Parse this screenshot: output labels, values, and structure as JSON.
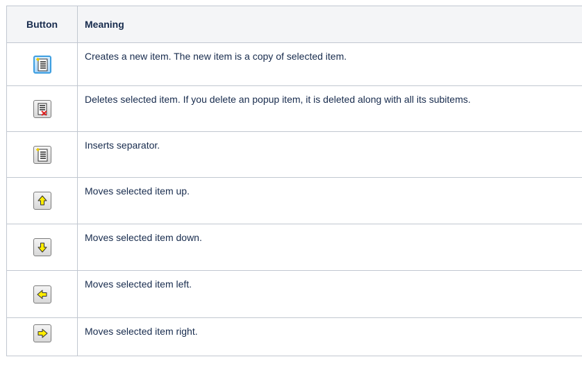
{
  "table": {
    "headers": {
      "button": "Button",
      "meaning": "Meaning"
    },
    "rows": [
      {
        "icon": "new-item-icon",
        "text": "Creates a new item. The new item is a copy of selected item."
      },
      {
        "icon": "delete-item-icon",
        "text": "Deletes selected item. If you delete an popup item, it is deleted along with all its subitems."
      },
      {
        "icon": "insert-separator-icon",
        "text": "Inserts separator."
      },
      {
        "icon": "arrow-up-icon",
        "text": "Moves selected item up."
      },
      {
        "icon": "arrow-down-icon",
        "text": "Moves selected item down."
      },
      {
        "icon": "arrow-left-icon",
        "text": "Moves selected item left."
      },
      {
        "icon": "arrow-right-icon",
        "text": "Moves selected item right."
      }
    ]
  },
  "colors": {
    "header_bg": "#f4f5f7",
    "border": "#c1c7d0",
    "arrow_fill": "#ffee00",
    "active_button_border": "#3c9ee0",
    "delete_mark": "#e02020"
  }
}
